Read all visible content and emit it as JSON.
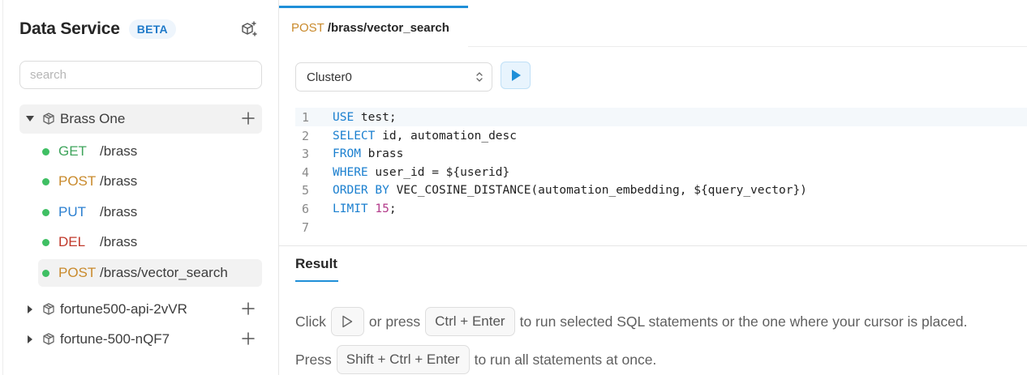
{
  "sidebar": {
    "title": "Data Service",
    "badge": "BETA",
    "search_placeholder": "search",
    "groups": [
      {
        "label": "Brass One",
        "expanded": true
      },
      {
        "label": "fortune500-api-2vVR",
        "expanded": false
      },
      {
        "label": "fortune-500-nQF7",
        "expanded": false
      }
    ],
    "endpoints": [
      {
        "method": "GET",
        "path": "/brass",
        "method_color": "#3fa45c"
      },
      {
        "method": "POST",
        "path": "/brass",
        "method_color": "#c98a2c"
      },
      {
        "method": "PUT",
        "path": "/brass",
        "method_color": "#2b7fd0"
      },
      {
        "method": "DEL",
        "path": "/brass",
        "method_color": "#c0392b"
      },
      {
        "method": "POST",
        "path": "/brass/vector_search",
        "method_color": "#c98a2c"
      }
    ],
    "status_dot_color": "#3fbf63"
  },
  "tab": {
    "method": "POST",
    "path": "/brass/vector_search"
  },
  "toolbar": {
    "cluster": "Cluster0"
  },
  "editor": {
    "lines": [
      {
        "num": "1",
        "kw": "USE",
        "rest": " test;"
      },
      {
        "num": "2",
        "kw": "SELECT",
        "rest": " id, automation_desc"
      },
      {
        "num": "3",
        "kw": "FROM",
        "rest": " brass"
      },
      {
        "num": "4",
        "kw": "WHERE",
        "rest": " user_id = ${userid}"
      },
      {
        "num": "5",
        "kw": "ORDER BY",
        "rest": " VEC_COSINE_DISTANCE(automation_embedding, ${query_vector})"
      },
      {
        "num": "6",
        "kw": "LIMIT",
        "num_val": "15",
        "rest": ";"
      },
      {
        "num": "7",
        "kw": "",
        "rest": ""
      }
    ]
  },
  "result": {
    "tab_label": "Result",
    "hint1": {
      "click": "Click",
      "or_press": "or press",
      "keys": "Ctrl + Enter",
      "tail": "to run selected SQL statements or the one where your cursor is placed."
    },
    "hint2": {
      "press": "Press",
      "keys": "Shift + Ctrl + Enter",
      "tail": "to run all statements at once."
    }
  },
  "colors": {
    "accent": "#1f8fd8",
    "keyword": "#1a7fcf",
    "number": "#b33a8a"
  }
}
